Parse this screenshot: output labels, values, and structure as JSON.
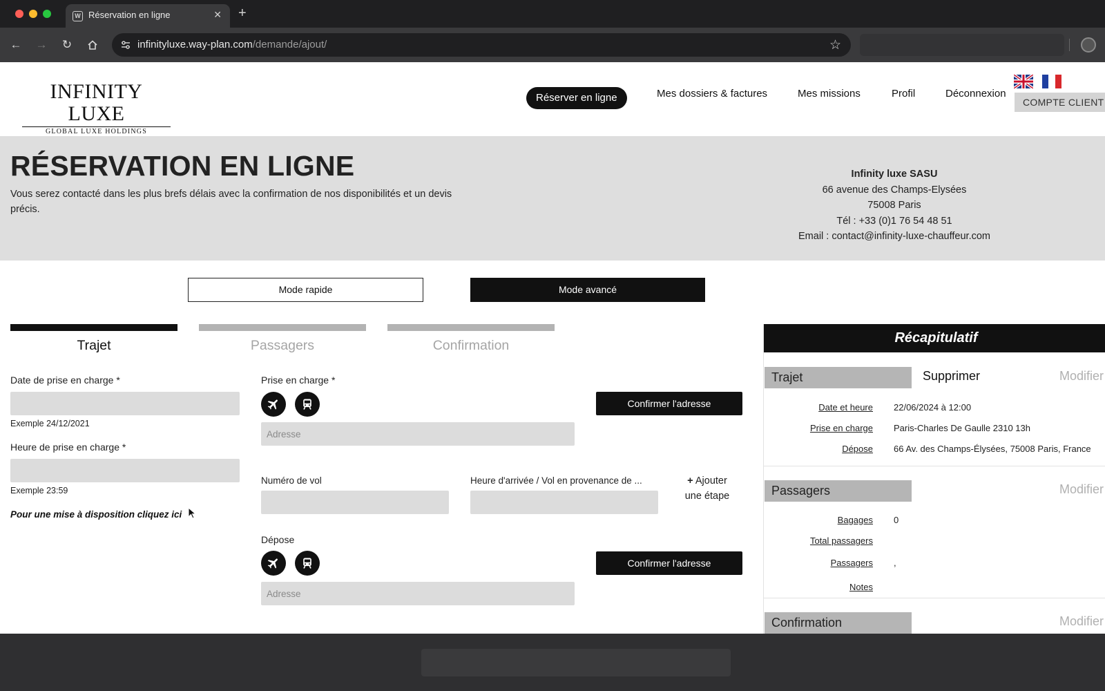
{
  "browser": {
    "tab_title": "Réservation en ligne",
    "tab_favicon_letter": "W",
    "url_host": "infinityluxe.way-plan.com",
    "url_path": "/demande/ajout/"
  },
  "header": {
    "logo_main": "INFINITY LUXE",
    "logo_sub": "GLOBAL LUXE HOLDINGS",
    "nav": {
      "reserver": "Réserver en ligne",
      "dossiers": "Mes dossiers & factures",
      "missions": "Mes missions",
      "profil": "Profil",
      "deconnexion": "Déconnexion"
    },
    "compte_client": "COMPTE CLIENT"
  },
  "hero": {
    "title": "RÉSERVATION EN LIGNE",
    "subtitle": "Vous serez contacté dans les plus brefs délais avec la confirmation de nos disponibilités et un devis précis.",
    "company": {
      "name": "Infinity luxe SASU",
      "address": "66 avenue des Champs-Elysées",
      "city": "75008 Paris",
      "phone": "Tél : +33 (0)1 76 54 48 51",
      "email_label": "Email : ",
      "email": "contact@infinity-luxe-chauffeur.com"
    }
  },
  "modes": {
    "rapide": "Mode rapide",
    "avance": "Mode avancé"
  },
  "steps": [
    "Trajet",
    "Passagers",
    "Confirmation"
  ],
  "form": {
    "date_label": "Date de prise en charge *",
    "date_hint": "Exemple 24/12/2021",
    "heure_label": "Heure de prise en charge *",
    "heure_hint": "Exemple 23:59",
    "dispo_link": "Pour une mise à disposition cliquez ici",
    "pickup_label": "Prise en charge *",
    "pickup_placeholder": "Adresse",
    "confirm_label": "Confirmer l'adresse",
    "vol_label": "Numéro de vol",
    "arrivee_label": "Heure d'arrivée / Vol en provenance de ...",
    "add_step_plus": "+",
    "add_step_text": "Ajouter une étape",
    "depose_label": "Dépose",
    "depose_placeholder": "Adresse"
  },
  "recap": {
    "title": "Récapitulatif",
    "modifier": "Modifier",
    "supprimer": "Supprimer",
    "trajet": {
      "tag": "Trajet",
      "rows": [
        {
          "key": "Date et heure",
          "value": "22/06/2024 à 12:00"
        },
        {
          "key": "Prise en charge",
          "value": "Paris-Charles De Gaulle 2310 13h"
        },
        {
          "key": "Dépose",
          "value": "66 Av. des Champs-Élysées, 75008 Paris, France"
        }
      ]
    },
    "passagers": {
      "tag": "Passagers",
      "rows": [
        {
          "key": "Bagages",
          "value": "0"
        },
        {
          "key": "Total passagers",
          "value": ""
        },
        {
          "key": "Passagers",
          "value": ","
        },
        {
          "key": "Notes",
          "value": ""
        }
      ]
    },
    "confirmation": {
      "tag": "Confirmation"
    }
  },
  "icons": {
    "pickup_plane": "plane-icon",
    "pickup_train": "train-icon",
    "depose_plane": "plane-icon",
    "depose_train": "train-icon"
  }
}
